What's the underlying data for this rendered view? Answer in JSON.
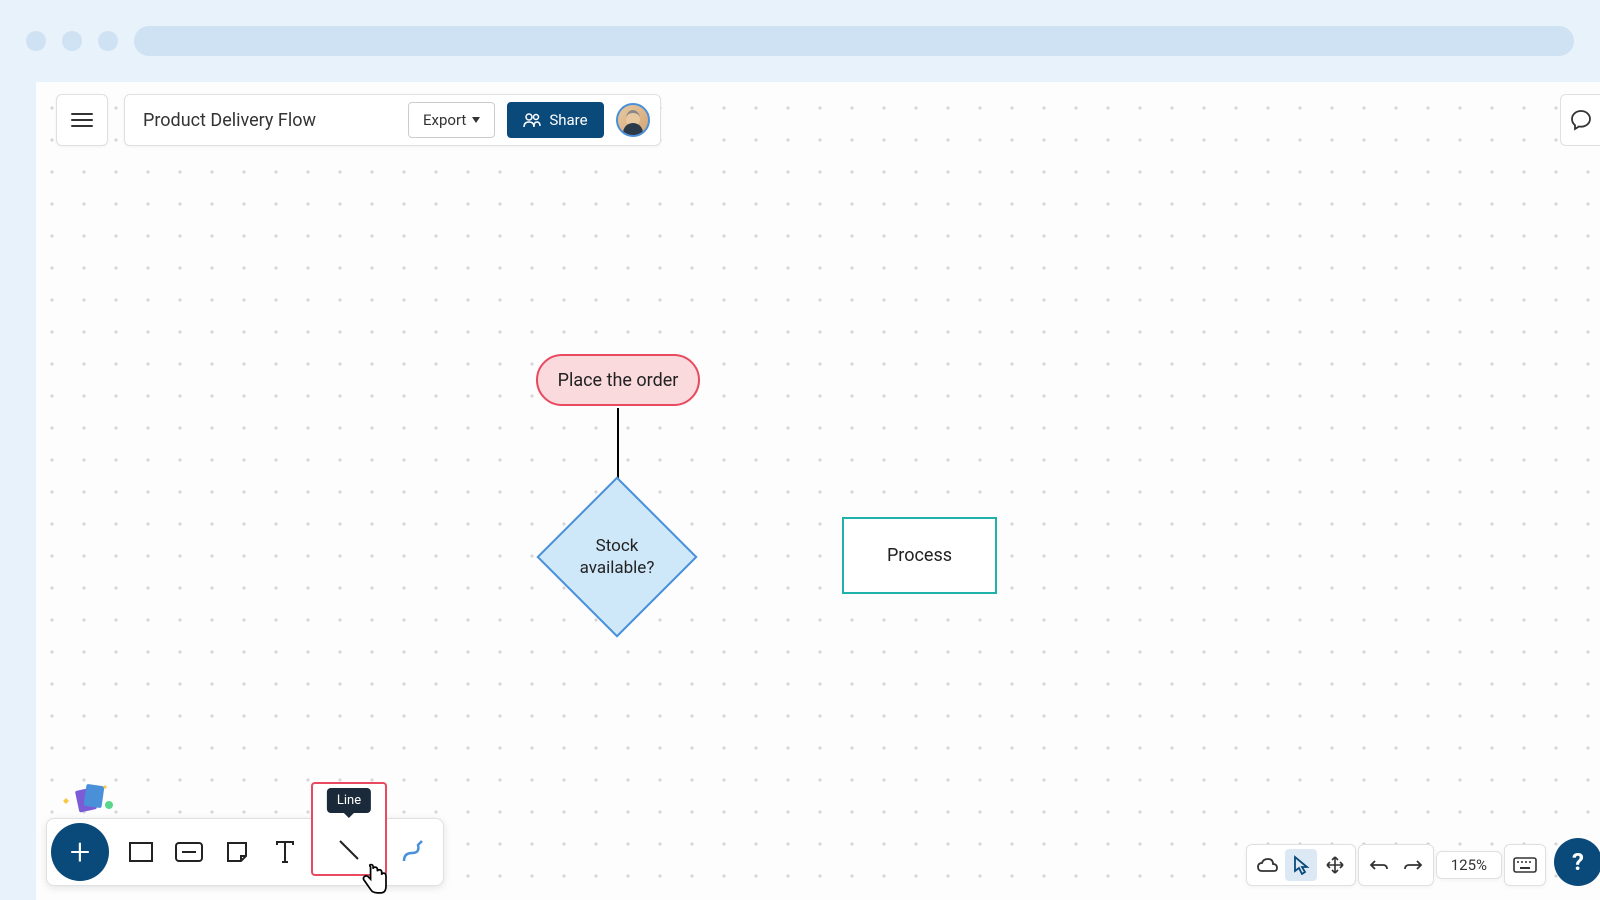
{
  "header": {
    "doc_title": "Product Delivery Flow",
    "export_label": "Export",
    "share_label": "Share"
  },
  "flowchart": {
    "nodes": {
      "start": {
        "label": "Place the order",
        "type": "terminator"
      },
      "decision": {
        "label": "Stock\navailable?",
        "type": "decision"
      },
      "process": {
        "label": "Process",
        "type": "process"
      }
    }
  },
  "toolbar": {
    "tools": [
      "rectangle",
      "container",
      "note",
      "text",
      "line",
      "draw"
    ],
    "tooltip_line": "Line"
  },
  "right_bar": {
    "zoom": "125%"
  }
}
